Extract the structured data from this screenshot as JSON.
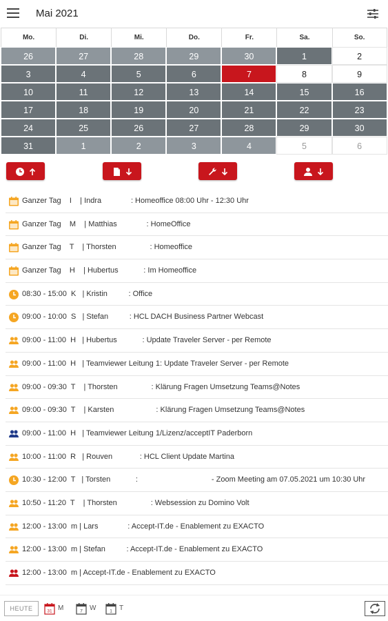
{
  "app": {
    "title": "Mai 2021"
  },
  "colors": {
    "accent": "#c8161d",
    "busy_day": "#6b7378",
    "outside_day": "#8e969c",
    "event_orange": "#f5a623",
    "event_navy": "#1f3a8a",
    "event_red": "#c8161d"
  },
  "calendar": {
    "weekdays": [
      "Mo.",
      "Di.",
      "Mi.",
      "Do.",
      "Fr.",
      "Sa.",
      "So."
    ],
    "days": [
      {
        "n": "26",
        "s": "outside"
      },
      {
        "n": "27",
        "s": "outside"
      },
      {
        "n": "28",
        "s": "outside"
      },
      {
        "n": "29",
        "s": "outside"
      },
      {
        "n": "30",
        "s": "outside"
      },
      {
        "n": "1",
        "s": "busy"
      },
      {
        "n": "2",
        "s": "free"
      },
      {
        "n": "3",
        "s": "busy"
      },
      {
        "n": "4",
        "s": "busy"
      },
      {
        "n": "5",
        "s": "busy"
      },
      {
        "n": "6",
        "s": "busy"
      },
      {
        "n": "7",
        "s": "today"
      },
      {
        "n": "8",
        "s": "free"
      },
      {
        "n": "9",
        "s": "free"
      },
      {
        "n": "10",
        "s": "busy"
      },
      {
        "n": "11",
        "s": "busy"
      },
      {
        "n": "12",
        "s": "busy"
      },
      {
        "n": "13",
        "s": "busy"
      },
      {
        "n": "14",
        "s": "busy"
      },
      {
        "n": "15",
        "s": "busy"
      },
      {
        "n": "16",
        "s": "busy"
      },
      {
        "n": "17",
        "s": "busy"
      },
      {
        "n": "18",
        "s": "busy"
      },
      {
        "n": "19",
        "s": "busy"
      },
      {
        "n": "20",
        "s": "busy"
      },
      {
        "n": "21",
        "s": "busy"
      },
      {
        "n": "22",
        "s": "busy"
      },
      {
        "n": "23",
        "s": "busy"
      },
      {
        "n": "24",
        "s": "busy"
      },
      {
        "n": "25",
        "s": "busy"
      },
      {
        "n": "26",
        "s": "busy"
      },
      {
        "n": "27",
        "s": "busy"
      },
      {
        "n": "28",
        "s": "busy"
      },
      {
        "n": "29",
        "s": "busy"
      },
      {
        "n": "30",
        "s": "busy"
      },
      {
        "n": "31",
        "s": "busy"
      },
      {
        "n": "1",
        "s": "outside"
      },
      {
        "n": "2",
        "s": "outside"
      },
      {
        "n": "3",
        "s": "outside"
      },
      {
        "n": "4",
        "s": "outside"
      },
      {
        "n": "5",
        "s": "free-out"
      },
      {
        "n": "6",
        "s": "free-out"
      }
    ]
  },
  "actions": [
    {
      "name": "clock-up-button",
      "icon": "clock-icon",
      "arrow": "up"
    },
    {
      "name": "document-down-button",
      "icon": "document-icon",
      "arrow": "down"
    },
    {
      "name": "wrench-down-button",
      "icon": "wrench-icon",
      "arrow": "down"
    },
    {
      "name": "person-down-button",
      "icon": "person-icon",
      "arrow": "down"
    }
  ],
  "events": [
    {
      "icon": "calendar-icon",
      "color": "orange",
      "text": "Ganzer Tag    I    | Indra              : Homeoffice 08:00 Uhr - 12:30 Uhr"
    },
    {
      "icon": "calendar-icon",
      "color": "orange",
      "text": "Ganzer Tag    M    | Matthias              : HomeOffice"
    },
    {
      "icon": "calendar-icon",
      "color": "orange",
      "text": "Ganzer Tag    T    | Thorsten                : Homeoffice"
    },
    {
      "icon": "calendar-icon",
      "color": "orange",
      "text": "Ganzer Tag    H    | Hubertus            : Im Homeoffice"
    },
    {
      "icon": "clock-icon",
      "color": "orange",
      "text": "08:30 - 15:00  K   | Kristin          : Office"
    },
    {
      "icon": "clock-icon",
      "color": "orange",
      "text": "09:00 - 10:00  S   | Stefan          : HCL DACH Business Partner Webcast"
    },
    {
      "icon": "people-icon",
      "color": "orange",
      "text": "09:00 - 11:00  H   | Hubertus            : Update Traveler Server - per Remote"
    },
    {
      "icon": "people-icon",
      "color": "orange",
      "text": "09:00 - 11:00  H   | Teamviewer Leitung 1: Update Traveler Server - per Remote"
    },
    {
      "icon": "people-icon",
      "color": "orange",
      "text": "09:00 - 09:30  T    | Thorsten                : Klärung Fragen Umsetzung Teams@Notes"
    },
    {
      "icon": "people-icon",
      "color": "orange",
      "text": "09:00 - 09:30  T    | Karsten                    : Klärung Fragen Umsetzung Teams@Notes"
    },
    {
      "icon": "people-icon",
      "color": "navy",
      "text": "09:00 - 11:00  H   | Teamviewer Leitung 1/Lizenz/acceptIT Paderborn"
    },
    {
      "icon": "people-icon",
      "color": "orange",
      "text": "10:00 - 11:00  R   | Rouven             : HCL Client Update Martina"
    },
    {
      "icon": "clock-icon",
      "color": "orange",
      "text": "10:30 - 12:00  T   | Torsten            :                                   - Zoom Meeting am 07.05.2021 um 10:30 Uhr"
    },
    {
      "icon": "people-icon",
      "color": "orange",
      "text": "10:50 - 11:20  T    | Thorsten                : Websession zu Domino Volt"
    },
    {
      "icon": "people-icon",
      "color": "orange",
      "text": "12:00 - 13:00  m | Lars              : Accept-IT.de - Enablement zu EXACTO"
    },
    {
      "icon": "people-icon",
      "color": "orange",
      "text": "12:00 - 13:00  m | Stefan          : Accept-IT.de - Enablement zu EXACTO"
    },
    {
      "icon": "people-icon",
      "color": "red",
      "text": "12:00 - 13:00  m | Accept-IT.de - Enablement zu EXACTO"
    }
  ],
  "bottom": {
    "today_label": "HEUTE",
    "views": [
      {
        "name": "view-month",
        "icon": "calendar-month-icon",
        "num": "31",
        "label": "M"
      },
      {
        "name": "view-week",
        "icon": "calendar-week-icon",
        "num": "7",
        "label": "W"
      },
      {
        "name": "view-day",
        "icon": "calendar-day-icon",
        "num": "1",
        "label": "T"
      }
    ]
  }
}
